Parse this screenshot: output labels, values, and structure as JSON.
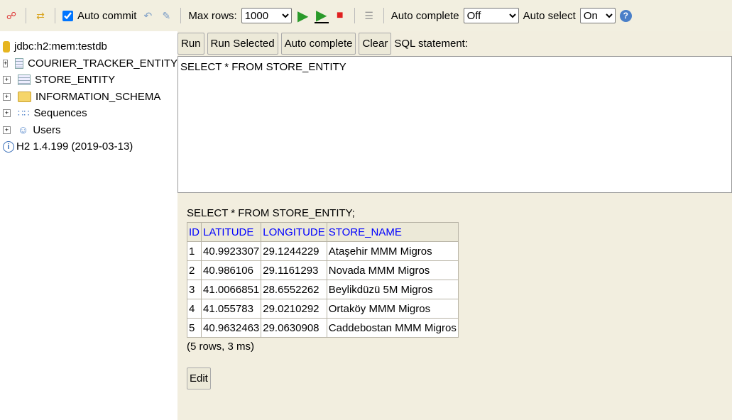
{
  "toolbar": {
    "auto_commit": "Auto commit",
    "max_rows_label": "Max rows:",
    "max_rows": "1000",
    "auto_complete_label": "Auto complete",
    "auto_complete": "Off",
    "auto_select_label": "Auto select",
    "auto_select": "On"
  },
  "tree": {
    "connection": "jdbc:h2:mem:testdb",
    "items": [
      "COURIER_TRACKER_ENTITY",
      "STORE_ENTITY",
      "INFORMATION_SCHEMA",
      "Sequences",
      "Users"
    ],
    "version": "H2 1.4.199 (2019-03-13)"
  },
  "buttons": {
    "run": "Run",
    "run_selected": "Run Selected",
    "auto_complete": "Auto complete",
    "clear": "Clear",
    "sql_label": "SQL statement:"
  },
  "editor": {
    "value": "SELECT * FROM STORE_ENTITY"
  },
  "results": {
    "query": "SELECT * FROM STORE_ENTITY;",
    "columns": [
      "ID",
      "LATITUDE",
      "LONGITUDE",
      "STORE_NAME"
    ],
    "rows": [
      [
        "1",
        "40.9923307",
        "29.1244229",
        "Ataşehir MMM Migros"
      ],
      [
        "2",
        "40.986106",
        "29.1161293",
        "Novada MMM Migros"
      ],
      [
        "3",
        "41.0066851",
        "28.6552262",
        "Beylikdüzü 5M Migros"
      ],
      [
        "4",
        "41.055783",
        "29.0210292",
        "Ortaköy MMM Migros"
      ],
      [
        "5",
        "40.9632463",
        "29.0630908",
        "Caddebostan MMM Migros"
      ]
    ],
    "summary": "(5 rows, 3 ms)",
    "edit": "Edit"
  }
}
